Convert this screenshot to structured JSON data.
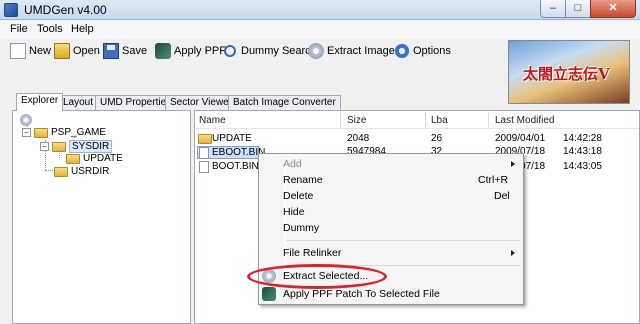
{
  "window": {
    "title": "UMDGen v4.00",
    "controls": {
      "minimize": "–",
      "maximize": "□",
      "close": "✕"
    }
  },
  "menubar": [
    "File",
    "Tools",
    "Help"
  ],
  "toolbar": {
    "new": "New",
    "open": "Open",
    "save": "Save",
    "apply_ppf": "Apply PPF",
    "dummy_search": "Dummy Search",
    "extract_image": "Extract Image",
    "options": "Options"
  },
  "banner": {
    "title": "太閤立志伝V"
  },
  "tabs": [
    "Explorer",
    "Layout",
    "UMD Properties",
    "Sector Viewer",
    "Batch Image Converter"
  ],
  "tree": {
    "root": "PSP_GAME",
    "sysdir": "SYSDIR",
    "update": "UPDATE",
    "usrdir": "USRDIR"
  },
  "filelist": {
    "columns": [
      "Name",
      "Size",
      "Lba",
      "Last Modified"
    ],
    "rows": [
      {
        "name": "UPDATE",
        "size": "2048",
        "lba": "26",
        "date": "2009/04/01",
        "time": "14:42:28"
      },
      {
        "name": "EBOOT.BIN",
        "size": "5947984",
        "lba": "32",
        "date": "2009/07/18",
        "time": "14:43:18"
      },
      {
        "name": "BOOT.BIN",
        "size": "",
        "lba": "",
        "date": "2009/07/18",
        "time": "14:43:05"
      }
    ]
  },
  "context_menu": {
    "add": "Add",
    "rename": "Rename",
    "rename_shortcut": "Ctrl+R",
    "delete": "Delete",
    "delete_shortcut": "Del",
    "hide": "Hide",
    "dummy": "Dummy",
    "file_relinker": "File Relinker",
    "extract_selected": "Extract Selected...",
    "apply_ppf_patch": "Apply PPF Patch To Selected File"
  },
  "colors": {
    "highlight_ellipse": "#d8242c",
    "selection": "#cde0f7"
  }
}
